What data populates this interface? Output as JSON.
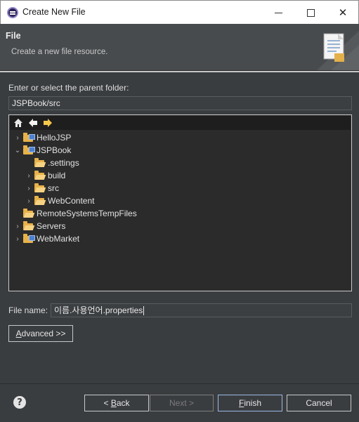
{
  "window": {
    "title": "Create New File",
    "min_icon": "minimize-icon",
    "max_icon": "maximize-icon",
    "close_glyph": "✕"
  },
  "header": {
    "title": "File",
    "description": "Create a new file resource."
  },
  "parent": {
    "label": "Enter or select the parent folder:",
    "value": "JSPBook/src"
  },
  "toolbar": {
    "home_icon": "home-icon",
    "back_icon": "back-arrow-icon",
    "forward_icon": "forward-arrow-icon"
  },
  "tree": [
    {
      "label": "HelloJSP",
      "depth": 0,
      "expander": "collapsed",
      "icon": "project"
    },
    {
      "label": "JSPBook",
      "depth": 0,
      "expander": "expanded",
      "icon": "project"
    },
    {
      "label": ".settings",
      "depth": 1,
      "expander": "none",
      "icon": "folder"
    },
    {
      "label": "build",
      "depth": 1,
      "expander": "collapsed",
      "icon": "folder"
    },
    {
      "label": "src",
      "depth": 1,
      "expander": "collapsed",
      "icon": "folder"
    },
    {
      "label": "WebContent",
      "depth": 1,
      "expander": "collapsed",
      "icon": "folder"
    },
    {
      "label": "RemoteSystemsTempFiles",
      "depth": 0,
      "expander": "none",
      "icon": "folder-open"
    },
    {
      "label": "Servers",
      "depth": 0,
      "expander": "collapsed",
      "icon": "folder-open"
    },
    {
      "label": "WebMarket",
      "depth": 0,
      "expander": "collapsed",
      "icon": "project"
    }
  ],
  "filename": {
    "label": "File name:",
    "value": "이름.사용언어.properties"
  },
  "advanced": {
    "label": "Advanced >>",
    "mnemonic": "A",
    "rest": "dvanced >>"
  },
  "buttons": {
    "help_glyph": "?",
    "back": {
      "pre": "< ",
      "mnemonic": "B",
      "rest": "ack"
    },
    "next": "Next >",
    "finish": {
      "mnemonic": "F",
      "rest": "inish"
    },
    "cancel": "Cancel"
  }
}
